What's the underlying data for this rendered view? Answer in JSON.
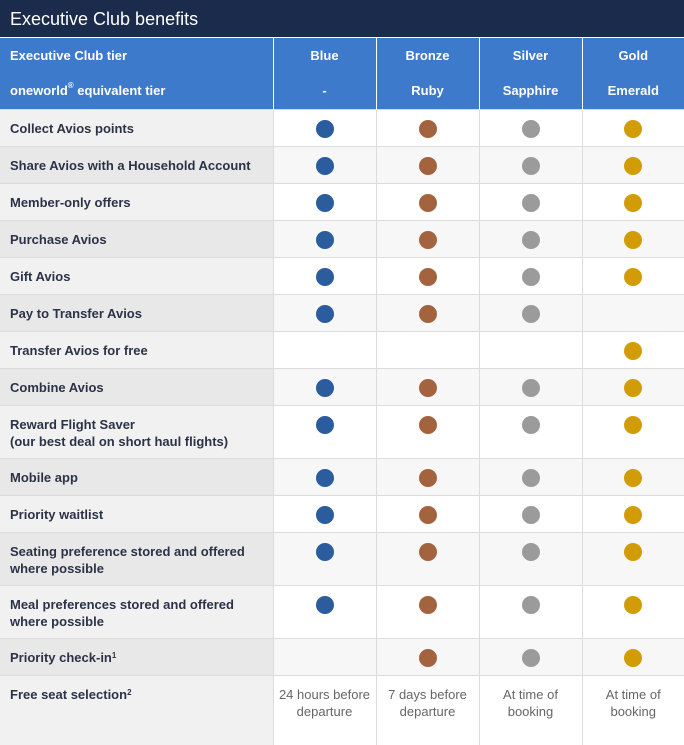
{
  "title": "Executive Club benefits",
  "header": {
    "tier_label": "Executive Club tier",
    "oneworld_label": "oneworld",
    "oneworld_sup": "®",
    "oneworld_suffix": " equivalent tier",
    "tiers": [
      {
        "name": "Blue",
        "oneworld": "-"
      },
      {
        "name": "Bronze",
        "oneworld": "Ruby"
      },
      {
        "name": "Silver",
        "oneworld": "Sapphire"
      },
      {
        "name": "Gold",
        "oneworld": "Emerald"
      }
    ]
  },
  "colors": {
    "blue": "#2a5c9e",
    "bronze": "#a3633f",
    "silver": "#9b9b9b",
    "gold": "#d29c06"
  },
  "rows": [
    {
      "label": "Collect Avios points",
      "values": [
        true,
        true,
        true,
        true
      ]
    },
    {
      "label": "Share Avios with a Household Account",
      "values": [
        true,
        true,
        true,
        true
      ]
    },
    {
      "label": "Member-only offers",
      "values": [
        true,
        true,
        true,
        true
      ]
    },
    {
      "label": "Purchase Avios",
      "values": [
        true,
        true,
        true,
        true
      ]
    },
    {
      "label": "Gift Avios",
      "values": [
        true,
        true,
        true,
        true
      ]
    },
    {
      "label": "Pay to Transfer Avios",
      "values": [
        true,
        true,
        true,
        false
      ]
    },
    {
      "label": "Transfer Avios for free",
      "values": [
        false,
        false,
        false,
        true
      ]
    },
    {
      "label": "Combine Avios",
      "values": [
        true,
        true,
        true,
        true
      ]
    },
    {
      "label": "Reward Flight Saver",
      "label2": "(our best deal on short haul flights)",
      "values": [
        true,
        true,
        true,
        true
      ]
    },
    {
      "label": "Mobile app",
      "values": [
        true,
        true,
        true,
        true
      ]
    },
    {
      "label": "Priority waitlist",
      "values": [
        true,
        true,
        true,
        true
      ]
    },
    {
      "label": "Seating preference stored and offered",
      "label2": "where possible",
      "values": [
        true,
        true,
        true,
        true
      ]
    },
    {
      "label": "Meal preferences stored and offered",
      "label2": "where possible",
      "values": [
        true,
        true,
        true,
        true
      ]
    },
    {
      "label": "Priority check-in",
      "sup": "1",
      "values": [
        false,
        true,
        true,
        true
      ]
    },
    {
      "label": "Free seat selection",
      "sup": "2",
      "values": [
        "24 hours before departure",
        "7 days before departure",
        "At time of booking",
        "At time of booking"
      ]
    }
  ]
}
